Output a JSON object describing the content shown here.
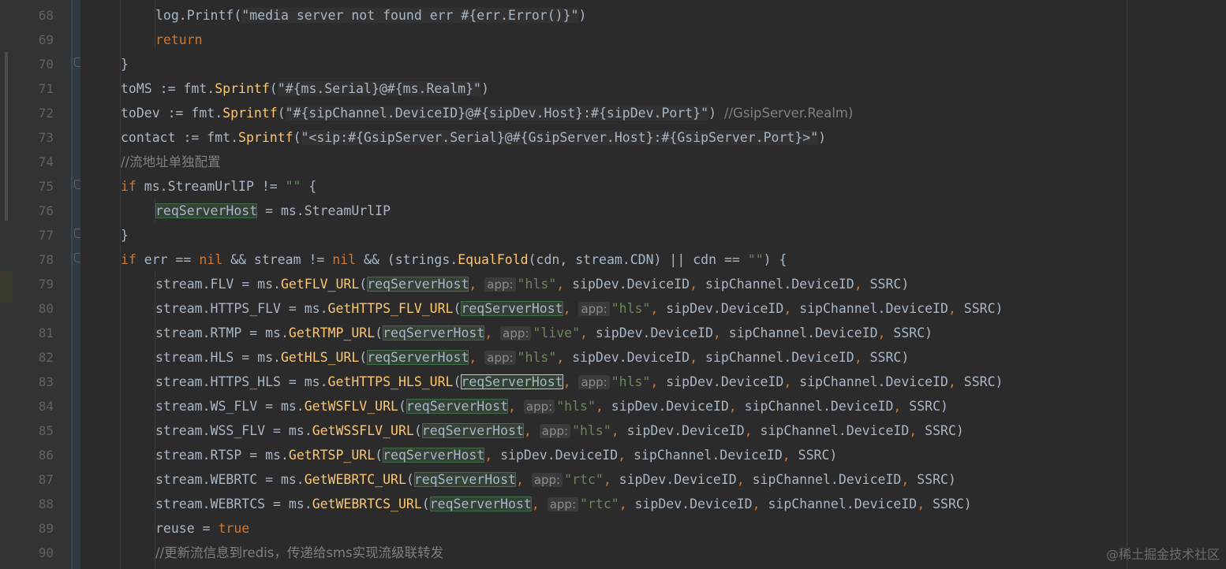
{
  "editor": {
    "lines": [
      {
        "num": "68"
      },
      {
        "num": "69"
      },
      {
        "num": "70"
      },
      {
        "num": "71"
      },
      {
        "num": "72"
      },
      {
        "num": "73"
      },
      {
        "num": "74"
      },
      {
        "num": "75"
      },
      {
        "num": "76"
      },
      {
        "num": "77"
      },
      {
        "num": "78"
      },
      {
        "num": "79"
      },
      {
        "num": "80"
      },
      {
        "num": "81"
      },
      {
        "num": "82"
      },
      {
        "num": "83"
      },
      {
        "num": "84"
      },
      {
        "num": "85"
      },
      {
        "num": "86"
      },
      {
        "num": "87"
      },
      {
        "num": "88"
      },
      {
        "num": "89"
      },
      {
        "num": "90"
      }
    ],
    "code": {
      "l68_call": "log.Printf(",
      "l68_str": "\"media server not found err #{err.Error()}\"",
      "l68_end": ")",
      "l69": "return",
      "l70": "}",
      "l71_a": "toMS := fmt.",
      "l71_fn": "Sprintf",
      "l71_str": "\"#{ms.Serial}@#{ms.Realm}\"",
      "l72_a": "toDev := fmt.",
      "l72_str": "\"#{sipChannel.DeviceID}@#{sipDev.Host}:#{sipDev.Port}\"",
      "l72_com": "//GsipServer.Realm)",
      "l73_a": "contact := fmt.",
      "l73_str": "\"<sip:#{GsipServer.Serial}@#{GsipServer.Host}:#{GsipServer.Port}>\"",
      "l74_com": "//流地址单独配置",
      "l75_rest": " ms.StreamUrlIP != ",
      "l75_str": "\"\"",
      "l75_brace": " {",
      "l76_var": "reqServerHost",
      "l76_rest": " = ms.StreamUrlIP",
      "l77": "}",
      "l78_a": " err == ",
      "l78_b": " && stream != ",
      "l78_c": " && (strings.",
      "l78_fn": "EqualFold",
      "l78_d": "(cdn, stream.CDN) || cdn == ",
      "l78_str": "\"\"",
      "l78_e": ") {",
      "l89_a": "reuse = ",
      "l89_b": "true",
      "l90_com": "//更新流信息到redis，传递给sms实现流级联转发"
    },
    "stream_lines": [
      {
        "lhs": "stream.FLV = ms.",
        "fn": "GetFLV_URL",
        "app": "\"hls\""
      },
      {
        "lhs": "stream.HTTPS_FLV = ms.",
        "fn": "GetHTTPS_FLV_URL",
        "app": "\"hls\""
      },
      {
        "lhs": "stream.RTMP = ms.",
        "fn": "GetRTMP_URL",
        "app": "\"live\""
      },
      {
        "lhs": "stream.HLS = ms.",
        "fn": "GetHLS_URL",
        "app": "\"hls\""
      },
      {
        "lhs": "stream.HTTPS_HLS = ms.",
        "fn": "GetHTTPS_HLS_URL",
        "app": "\"hls\""
      },
      {
        "lhs": "stream.WS_FLV = ms.",
        "fn": "GetWSFLV_URL",
        "app": "\"hls\""
      },
      {
        "lhs": "stream.WSS_FLV = ms.",
        "fn": "GetWSSFLV_URL",
        "app": "\"hls\""
      },
      {
        "lhs": "stream.RTSP = ms.",
        "fn": "GetRTSP_URL",
        "app": ""
      },
      {
        "lhs": "stream.WEBRTC = ms.",
        "fn": "GetWEBRTC_URL",
        "app": "\"rtc\""
      },
      {
        "lhs": "stream.WEBRTCS = ms.",
        "fn": "GetWEBRTCS_URL",
        "app": "\"rtc\""
      }
    ],
    "tokens": {
      "kw_if": "if",
      "kw_nil": "nil",
      "arg": "reqServerHost",
      "hint": "app:",
      "tail_a": " sipDev.DeviceID",
      "tail_b": " sipChannel.DeviceID",
      "tail_c": " SSRC)",
      "comma": ",",
      "open": "(",
      "close": ")"
    }
  },
  "watermark": "@稀土掘金技术社区"
}
